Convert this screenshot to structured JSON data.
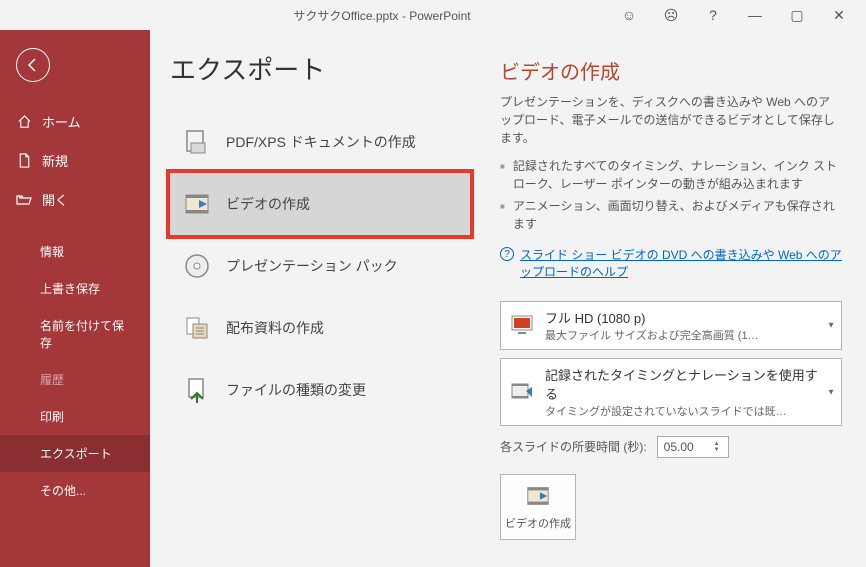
{
  "title": "サクサクOffice.pptx - PowerPoint",
  "sidebar": {
    "home": "ホーム",
    "new": "新規",
    "open": "開く",
    "info": "情報",
    "save": "上書き保存",
    "saveas": "名前を付けて保存",
    "history": "履歴",
    "print": "印刷",
    "export": "エクスポート",
    "other": "その他..."
  },
  "page_title": "エクスポート",
  "export_items": {
    "pdf": "PDF/XPS ドキュメントの作成",
    "video": "ビデオの作成",
    "pack": "プレゼンテーション パック",
    "handout": "配布資料の作成",
    "filetype": "ファイルの種類の変更"
  },
  "right": {
    "title": "ビデオの作成",
    "desc": "プレゼンテーションを、ディスクへの書き込みや Web へのアップロード、電子メールでの送信ができるビデオとして保存します。",
    "b1": "記録されたすべてのタイミング、ナレーション、インク ストローク、レーザー ポインターの動きが組み込まれます",
    "b2": "アニメーション、画面切り替え、およびメディアも保存されます",
    "help": "スライド ショー ビデオの DVD への書き込みや Web へのアップロードのヘルプ",
    "dd1_title": "フル HD (1080 p)",
    "dd1_sub": "最大ファイル サイズおよび完全高画質 (1…",
    "dd2_title": "記録されたタイミングとナレーションを使用する",
    "dd2_sub": "タイミングが設定されていないスライドでは既…",
    "time_label": "各スライドの所要時間 (秒):",
    "time_value": "05.00",
    "create_label": "ビデオの作成"
  }
}
